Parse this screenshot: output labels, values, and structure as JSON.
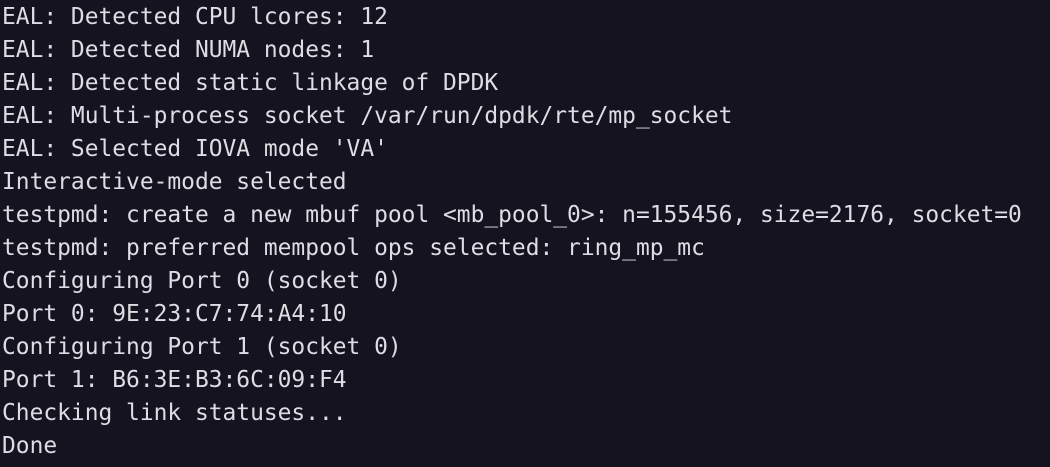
{
  "terminal": {
    "lines": [
      "EAL: Detected CPU lcores: 12",
      "EAL: Detected NUMA nodes: 1",
      "EAL: Detected static linkage of DPDK",
      "EAL: Multi-process socket /var/run/dpdk/rte/mp_socket",
      "EAL: Selected IOVA mode 'VA'",
      "Interactive-mode selected",
      "testpmd: create a new mbuf pool <mb_pool_0>: n=155456, size=2176, socket=0",
      "testpmd: preferred mempool ops selected: ring_mp_mc",
      "Configuring Port 0 (socket 0)",
      "Port 0: 9E:23:C7:74:A4:10",
      "Configuring Port 1 (socket 0)",
      "Port 1: B6:3E:B3:6C:09:F4",
      "Checking link statuses...",
      "Done"
    ]
  }
}
